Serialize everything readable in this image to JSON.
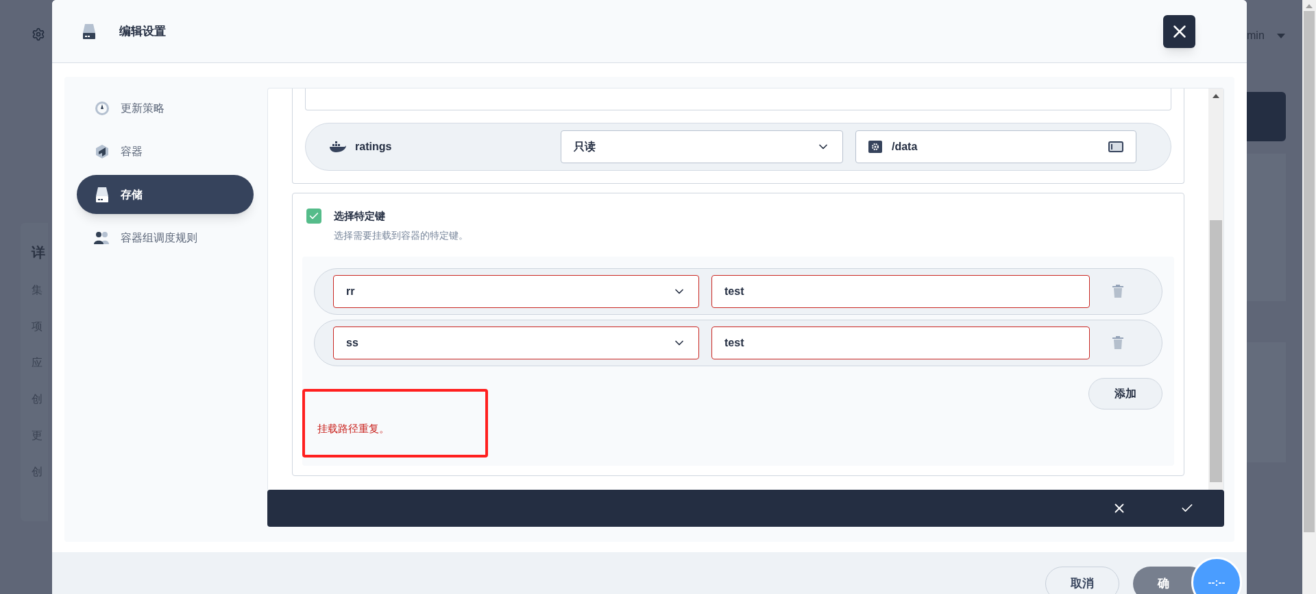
{
  "background": {
    "left_fragments": [
      "详",
      "集",
      "项",
      "应",
      "创",
      "更",
      "创"
    ],
    "user_fragment": "min"
  },
  "dialog": {
    "title": "编辑设置",
    "nav": [
      {
        "label": "更新策略",
        "kind": "gauge",
        "selected": false
      },
      {
        "label": "容器",
        "kind": "cube",
        "selected": false
      },
      {
        "label": "存储",
        "kind": "drive",
        "selected": true
      },
      {
        "label": "容器组调度规则",
        "kind": "users",
        "selected": false
      }
    ],
    "mount": {
      "container": "ratings",
      "access": "只读",
      "path": "/data"
    },
    "specific_keys": {
      "checked": true,
      "label": "选择特定键",
      "hint": "选择需要挂载到容器的特定键。",
      "items": [
        {
          "key": "rr",
          "path": "test",
          "invalid": true
        },
        {
          "key": "ss",
          "path": "test",
          "invalid": true
        }
      ],
      "add": "添加",
      "error": "挂载路径重复。"
    },
    "footer": {
      "cancel": "取消",
      "confirm": "确"
    }
  },
  "timer": "--:--"
}
